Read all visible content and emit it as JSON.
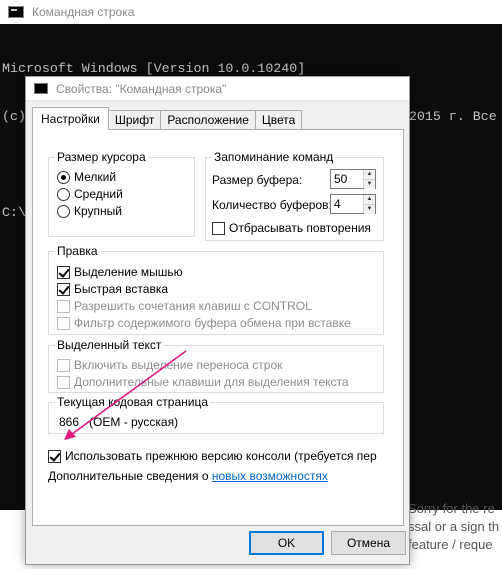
{
  "console": {
    "title": "Командная строка",
    "lines": [
      "Microsoft Windows [Version 10.0.10240]",
      "(c) Корпорация Майкрософт (Microsoft Corporation), 2015 г. Все",
      "",
      "C:\\"
    ]
  },
  "background_web": {
    "lines": [
      "Sorry for the re",
      "ssal or a sign th",
      "feature / reque"
    ]
  },
  "dialog": {
    "title": "Свойства: \"Командная строка\"",
    "tabs": [
      "Настройки",
      "Шрифт",
      "Расположение",
      "Цвета"
    ],
    "active_tab": "Настройки",
    "cursor_size": {
      "legend": "Размер курсора",
      "options": [
        "Мелкий",
        "Средний",
        "Крупный"
      ],
      "selected": "Мелкий"
    },
    "command_history": {
      "legend": "Запоминание команд",
      "buffer_size_label": "Размер буфера:",
      "buffer_size_value": "50",
      "buffer_count_label": "Количество буферов:",
      "buffer_count_value": "4",
      "discard_duplicates_label": "Отбрасывать повторения"
    },
    "edit": {
      "legend": "Правка",
      "quick_edit_label": "Выделение мышью",
      "insert_mode_label": "Быстрая вставка",
      "ctrl_keys_label": "Разрешить сочетания клавиш с CONTROL",
      "filter_paste_label": "Фильтр содержимого буфера обмена при вставке"
    },
    "text_selection": {
      "legend": "Выделенный текст",
      "line_wrap_label": "Включить выделение переноса строк",
      "extended_keys_label": "Дополнительные клавиши для выделения текста"
    },
    "codepage": {
      "legend": "Текущая кодовая страница",
      "value": "866   (OEM - русская)"
    },
    "legacy_console_label": "Использовать прежнюю версию консоли (требуется пер",
    "more_info_prefix": "Дополнительные сведения о ",
    "more_info_link": "новых возможностях",
    "ok_label": "OK",
    "cancel_label": "Отмена"
  },
  "colors": {
    "arrow": "#e0197d",
    "console_bg": "#0c0c0c",
    "console_text": "#c0c0c0",
    "link": "#0066cc",
    "default_button_border": "#0078d7"
  }
}
